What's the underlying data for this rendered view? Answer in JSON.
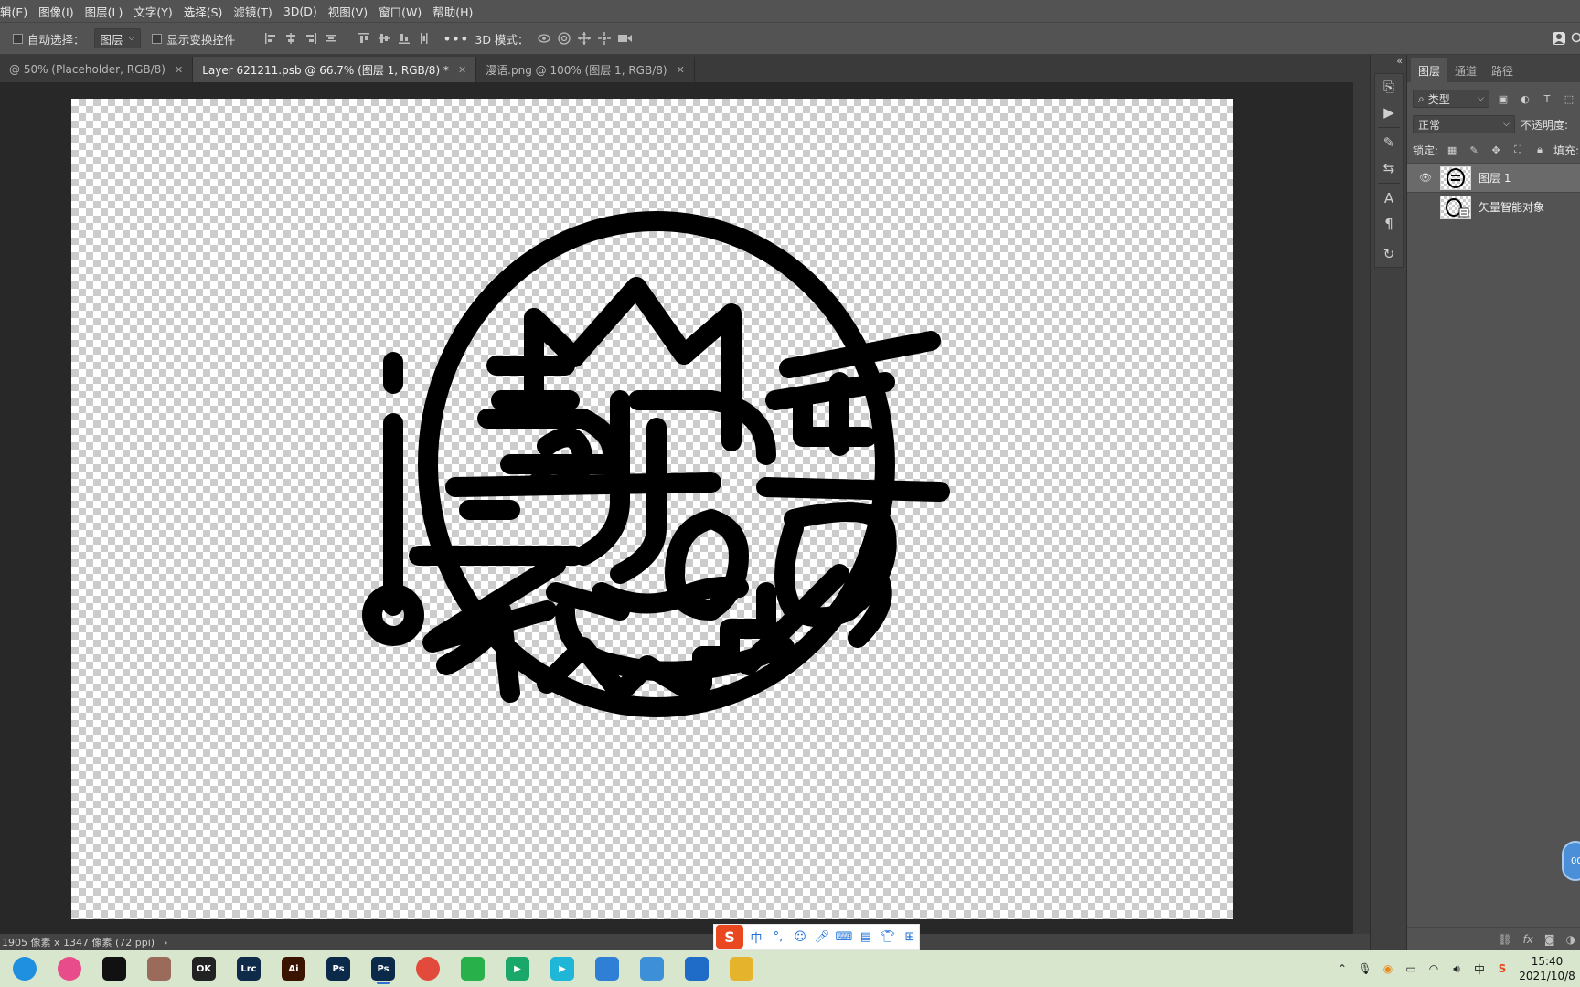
{
  "menu": [
    "辑(E)",
    "图像(I)",
    "图层(L)",
    "文字(Y)",
    "选择(S)",
    "滤镜(T)",
    "3D(D)",
    "视图(V)",
    "窗口(W)",
    "帮助(H)"
  ],
  "options": {
    "auto_select_label": "自动选择：",
    "auto_select_value": "图层",
    "show_transform_label": "显示变换控件",
    "mode3d_label": "3D 模式："
  },
  "tabs": [
    {
      "label": "@ 50% (Placeholder, RGB/8)",
      "active": false
    },
    {
      "label": "Layer 621211.psb @ 66.7% (图层 1, RGB/8) *",
      "active": true
    },
    {
      "label": "漫语.png @ 100% (图层 1, RGB/8)",
      "active": false
    }
  ],
  "status": {
    "dimensions": "1905 像素 x 1347 像素 (72 ppi)",
    "arrow": "›"
  },
  "panel": {
    "tabs": [
      "图层",
      "通道",
      "路径"
    ],
    "filter_label": "类型",
    "blend_mode": "正常",
    "opacity_label": "不透明度:",
    "lock_label": "锁定:",
    "fill_label": "填充:",
    "layers": [
      {
        "name": "图层 1",
        "selected": true,
        "visible": true
      },
      {
        "name": "矢量智能对象",
        "selected": false,
        "visible": false
      }
    ]
  },
  "floating_badge": "00",
  "taskbar": {
    "time": "15:40",
    "date": "2021/10/8",
    "apps": [
      {
        "name": "edge",
        "color": "#1f8fe0",
        "text": ""
      },
      {
        "name": "chrome-alt",
        "color": "#e94c8a",
        "text": ""
      },
      {
        "name": "qq",
        "color": "#111",
        "text": ""
      },
      {
        "name": "game",
        "color": "#9a6b5b",
        "text": ""
      },
      {
        "name": "ok-app",
        "color": "#222",
        "text": "OK"
      },
      {
        "name": "lightroom",
        "color": "#0f2b4a",
        "text": "Lrc"
      },
      {
        "name": "illustrator",
        "color": "#3a1400",
        "text": "Ai"
      },
      {
        "name": "photoshop-a",
        "color": "#0b2a4a",
        "text": "Ps"
      },
      {
        "name": "photoshop-b",
        "color": "#0b2a4a",
        "text": "Ps"
      },
      {
        "name": "chrome",
        "color": "#e24b3b",
        "text": ""
      },
      {
        "name": "wechat",
        "color": "#28b04b",
        "text": ""
      },
      {
        "name": "player-a",
        "color": "#1aa86a",
        "text": "▶"
      },
      {
        "name": "player-b",
        "color": "#1fb6d8",
        "text": "▶"
      },
      {
        "name": "notepad",
        "color": "#2f7fd6",
        "text": ""
      },
      {
        "name": "book",
        "color": "#3d8fd8",
        "text": ""
      },
      {
        "name": "bag",
        "color": "#1e6cc8",
        "text": ""
      },
      {
        "name": "explorer",
        "color": "#e6b32d",
        "text": ""
      }
    ]
  }
}
